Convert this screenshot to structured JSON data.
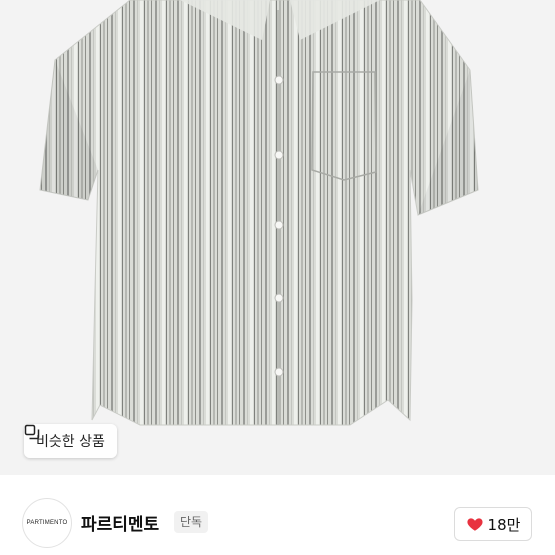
{
  "similar_products": {
    "label": "비슷한 상품",
    "icon": "copy-icon"
  },
  "seller": {
    "logo_text": "PARTIMENTO",
    "name": "파르티멘토",
    "tag": "단독"
  },
  "like": {
    "icon": "heart-icon",
    "color": "#e8323f",
    "count": "18만"
  },
  "colors": {
    "image_background": "#f3f3f3",
    "shirt_base": "#d9dbd6"
  }
}
